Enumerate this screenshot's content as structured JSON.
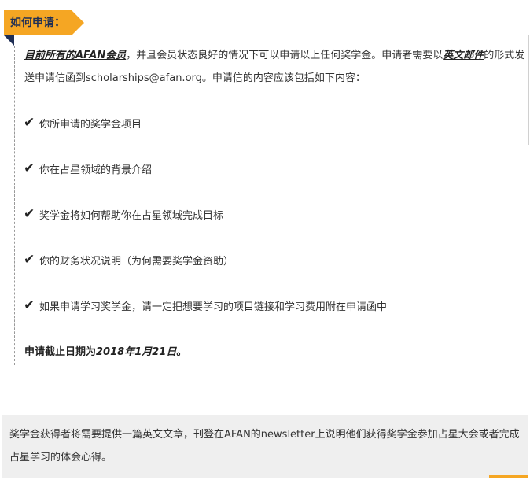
{
  "section": {
    "tag": "如何申请："
  },
  "intro": {
    "em1": "目前所有的AFAN会员",
    "text1": "，并且会员状态良好的情况下可以申请以上任何奖学金。申请者需要以",
    "em2": "英文邮件",
    "text2": "的形式发送申请信函到scholarships@afan.org。申请信的内容应该包括如下内容："
  },
  "check_glyph": "✔",
  "items": [
    "你所申请的奖学金项目",
    "你在占星领域的背景介绍",
    "奖学金将如何帮助你在占星领域完成目标",
    "你的财务状况说明（为何需要奖学金资助）",
    "如果申请学习奖学金，请一定把想要学习的项目链接和学习费用附在申请函中"
  ],
  "deadline": {
    "label": "申请截止日期为",
    "date": "2018年1月21日",
    "end": "。"
  },
  "note": "奖学金获得者将需要提供一篇英文文章，刊登在AFAN的newsletter上说明他们获得奖学金参加占星大会或者完成占星学习的体会心得。",
  "colors": {
    "accent": "#f5a623",
    "navy": "#1f2f55",
    "box_bg": "#efefef"
  }
}
